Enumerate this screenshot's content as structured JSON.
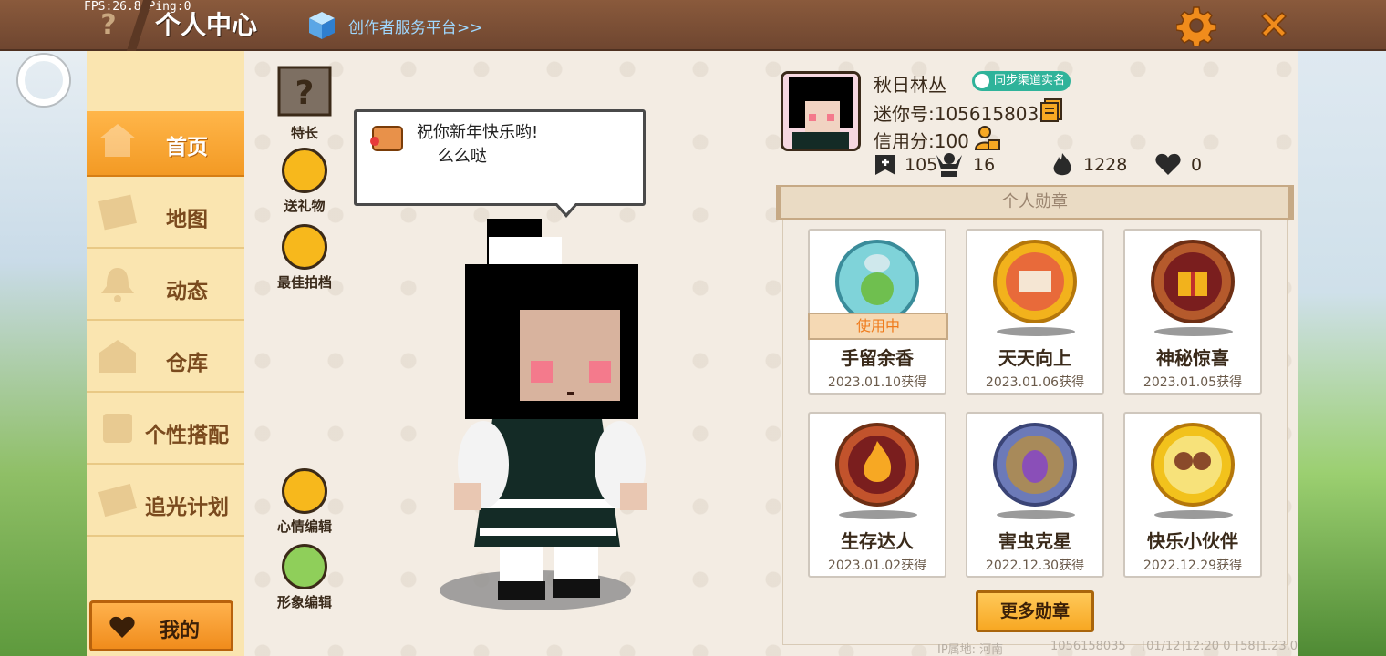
{
  "debug": {
    "fps": "FPS:26.8",
    "ping": "Ping:0"
  },
  "header": {
    "title": "个人中心",
    "creator_link": "创作者服务平台>>",
    "help_icon": "question-icon",
    "settings_icon": "gear-icon",
    "close_icon": "close-icon"
  },
  "sidebar": {
    "items": [
      {
        "label": "首页",
        "icon": "home-icon",
        "active": true
      },
      {
        "label": "地图",
        "icon": "map-icon",
        "active": false
      },
      {
        "label": "动态",
        "icon": "bell-icon",
        "active": false
      },
      {
        "label": "仓库",
        "icon": "warehouse-icon",
        "active": false
      },
      {
        "label": "个性搭配",
        "icon": "outfit-icon",
        "active": false
      },
      {
        "label": "追光计划",
        "icon": "light-plan-icon",
        "active": false
      }
    ],
    "my_button": {
      "label": "我的",
      "icon": "heart-icon"
    }
  },
  "actions": {
    "specialty": "特长",
    "gift": "送礼物",
    "best_partner": "最佳拍档",
    "mood_edit": "心情编辑",
    "image_edit": "形象编辑"
  },
  "speech": {
    "message_line1": "祝你新年快乐哟!",
    "message_line2": "    么么哒"
  },
  "profile": {
    "name": "秋日林丛",
    "verify_badge": "同步渠道实名",
    "mini_id": "迷你号:1056158035",
    "credit": "信用分:100",
    "stats": {
      "saved": "105",
      "followers": "16",
      "heat": "1228",
      "likes": "0"
    }
  },
  "medals": {
    "header": "个人勋章",
    "in_use_label": "使用中",
    "items": [
      {
        "name": "手留余香",
        "date": "2023.01.10获得",
        "in_use": true,
        "color": "#7fd3d9"
      },
      {
        "name": "天天向上",
        "date": "2023.01.06获得",
        "in_use": false,
        "color": "#f2b21c"
      },
      {
        "name": "神秘惊喜",
        "date": "2023.01.05获得",
        "in_use": false,
        "color": "#b55a2c"
      },
      {
        "name": "生存达人",
        "date": "2023.01.02获得",
        "in_use": false,
        "color": "#c2532c"
      },
      {
        "name": "害虫克星",
        "date": "2022.12.30获得",
        "in_use": false,
        "color": "#6c7ab8"
      },
      {
        "name": "快乐小伙伴",
        "date": "2022.12.29获得",
        "in_use": false,
        "color": "#f2c21c"
      }
    ],
    "more_button": "更多勋章"
  },
  "footer": {
    "ip_location": "IP属地: 河南",
    "uid": "1056158035",
    "time": "[01/12]12:20 0",
    "version": "[58]1.23.0"
  }
}
